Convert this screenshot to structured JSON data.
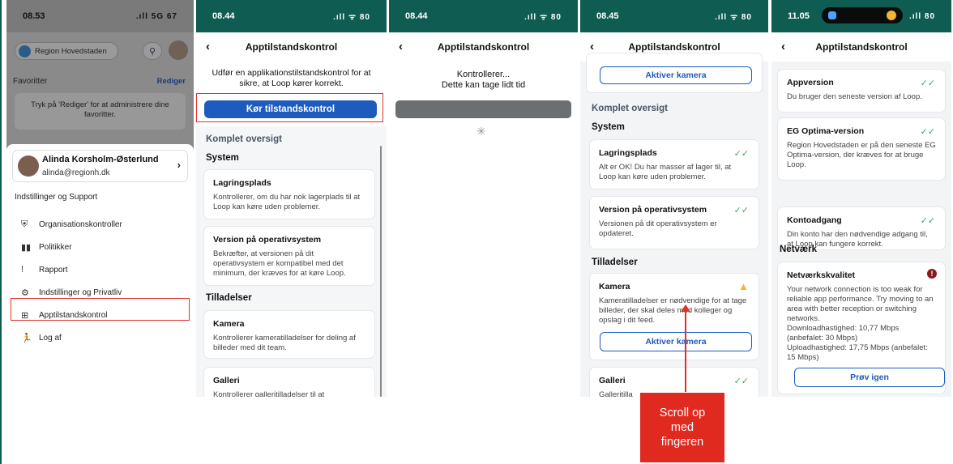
{
  "phone1": {
    "time": "08.53",
    "status_icons": ".ıll 5G 67",
    "org_chip": "Region Hovedstaden",
    "favorites_label": "Favoritter",
    "edit_label": "Rediger",
    "favorites_hint": "Tryk på 'Rediger' for at administrere dine favoritter.",
    "profile_name": "Alinda Korsholm-Østerlund",
    "profile_email": "alinda@regionh.dk",
    "settings_heading": "Indstillinger og Support",
    "menu": [
      {
        "icon": "shield-icon",
        "glyph": "⛨",
        "label": "Organisationskontroller"
      },
      {
        "icon": "book-icon",
        "glyph": "▮▮",
        "label": "Politikker"
      },
      {
        "icon": "exclamation-icon",
        "glyph": "!",
        "label": "Rapport"
      },
      {
        "icon": "gear-icon",
        "glyph": "⚙",
        "label": "Indstillinger og Privatliv"
      },
      {
        "icon": "plus-square-icon",
        "glyph": "⊞",
        "label": "Apptilstandskontrol"
      },
      {
        "icon": "logout-runner-icon",
        "glyph": "🏃",
        "label": "Log af"
      }
    ]
  },
  "phone2": {
    "time": "08.44",
    "status_icons": ".ıll ᯤ 80",
    "title": "Apptilstandskontrol",
    "intro": "Udfør en applikationstilstandskontrol for at sikre, at Loop kører korrekt.",
    "run_button": "Kør tilstandskontrol",
    "overview": "Komplet oversigt",
    "system": "System",
    "storage_title": "Lagringsplads",
    "storage_text": "Kontrollerer, om du har nok lagerplads til at Loop kan køre uden problemer.",
    "os_title": "Version på operativsystem",
    "os_text": "Bekræfter, at versionen på dit operativsystem er kompatibel med det minimum, der kræves for at køre Loop.",
    "permissions": "Tilladelser",
    "camera_title": "Kamera",
    "camera_text": "Kontrollerer kameratilladelser for deling af billeder med dit team.",
    "gallery_title": "Galleri",
    "gallery_text": "Kontrollerer galleritilladelser til at"
  },
  "phone3": {
    "time": "08.44",
    "status_icons": ".ıll ᯤ 80",
    "title": "Apptilstandskontrol",
    "checking_line1": "Kontrollerer...",
    "checking_line2": "Dette kan tage lidt tid"
  },
  "phone4": {
    "time": "08.45",
    "status_icons": ".ıll ᯤ 80",
    "title": "Apptilstandskontrol",
    "activate_camera": "Aktiver kamera",
    "overview": "Komplet oversigt",
    "system": "System",
    "storage_title": "Lagringsplads",
    "storage_text": "Alt er OK! Du har masser af lager til, at Loop kan køre uden problemer.",
    "os_title": "Version på operativsystem",
    "os_text": "Versionen på dit operativsystem er opdateret.",
    "permissions": "Tilladelser",
    "camera_title": "Kamera",
    "camera_text": "Kameratilladelser er nødvendige for at tage billeder, der skal deles med kolleger og opslag i dit feed.",
    "activate_camera2": "Aktiver kamera",
    "gallery_title": "Galleri",
    "gallery_text": "Galleritilla"
  },
  "phone5": {
    "time": "11.05",
    "status_icons": ".ıll 80",
    "title": "Apptilstandskontrol",
    "appversion_title": "Appversion",
    "appversion_text": "Du bruger den seneste version af Loop.",
    "eg_title": "EG Optima-version",
    "eg_text": "Region Hovedstaden er på den seneste EG Optima-version, der kræves for at bruge Loop.",
    "account_title": "Kontoadgang",
    "account_text": "Din konto har den nødvendige adgang til, at Loop kan fungere korrekt.",
    "network": "Netværk",
    "netq_title": "Netværkskvalitet",
    "netq_text": "Your network connection is too weak for reliable app performance. Try moving to an area with better reception or switching networks.",
    "download": "Downloadhastighed: 10,77 Mbps (anbefalet: 30 Mbps)",
    "upload": "Uploadhastighed: 17,75 Mbps (anbefalet: 15 Mbps)",
    "retry": "Prøv igen"
  },
  "callout": "Scroll op med fingeren",
  "colors": {
    "teal": "#0f5d52",
    "blue": "#1d5bbf",
    "red": "#e0302a",
    "green": "#3da35d",
    "warning": "#f2b534"
  }
}
